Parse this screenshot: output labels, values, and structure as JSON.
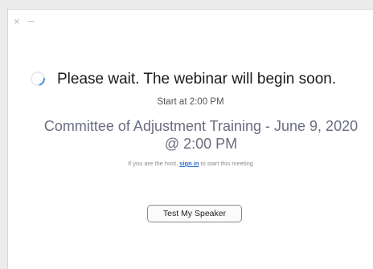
{
  "titlebar": {
    "close_symbol": "×",
    "minimize_symbol": "–"
  },
  "status": {
    "wait_message": "Please wait. The webinar will begin soon.",
    "spinner_icon": "loading-spinner-icon"
  },
  "webinar": {
    "start_time": "Start at 2:00 PM",
    "title": "Committee of Adjustment Training - June 9, 2020 @ 2:00 PM"
  },
  "host_note": {
    "prefix": "If you are the host,",
    "link_label": "sign in",
    "suffix": "to start this meeting"
  },
  "actions": {
    "test_speaker_label": "Test My Speaker"
  },
  "colors": {
    "title_color": "#6a6d80",
    "link_color": "#2d6cd1",
    "spinner_color": "#4a90e2"
  }
}
